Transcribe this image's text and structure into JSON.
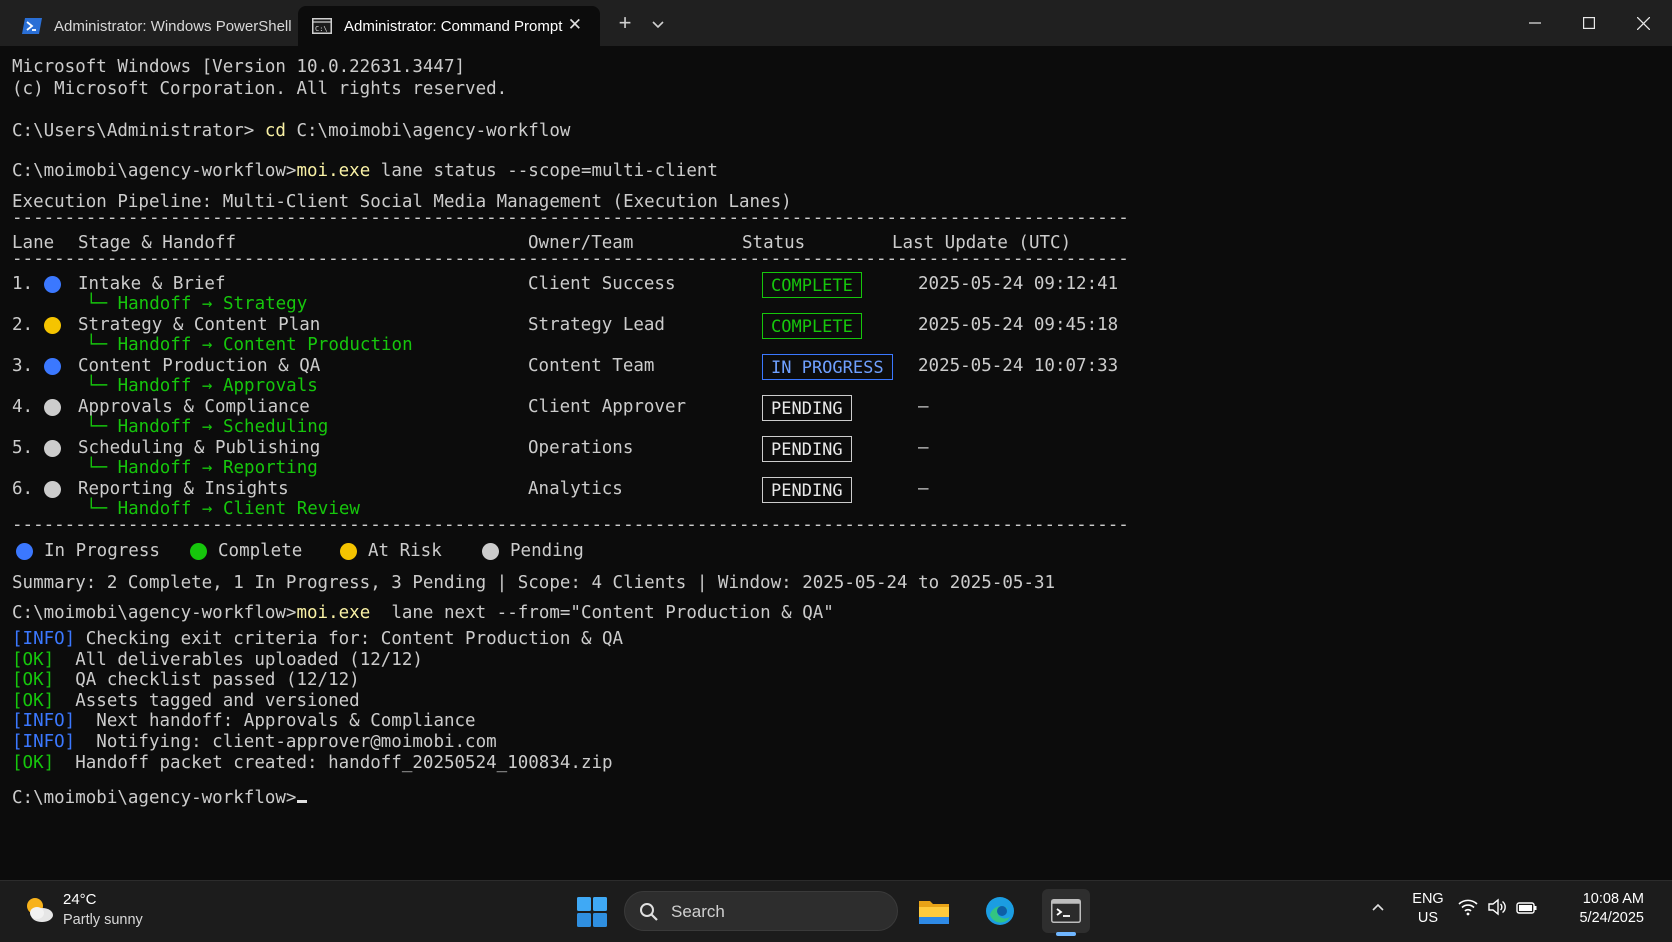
{
  "window": {
    "tabs": [
      {
        "label": "Administrator: Windows PowerShell",
        "icon": "powershell-icon"
      },
      {
        "label": "Administrator: Command Prompt",
        "icon": "cmd-icon",
        "active": true
      }
    ],
    "new_tab": "+",
    "dropdown": "chevron-down-icon",
    "controls": [
      "minimize-icon",
      "maximize-icon",
      "close-icon"
    ]
  },
  "terminal": {
    "banner_1": "Microsoft Windows [Version 10.0.22631.3447]",
    "banner_2": "(c) Microsoft Corporation. All rights reserved.",
    "prompt_1": "C:\\Users\\Administrator> ",
    "cmd_1_keyword": "cd",
    "cmd_1_rest": " C:\\moimobi\\agency-workflow",
    "prompt_2": "C:\\moimobi\\agency-workflow>",
    "cmd_2_exe": "moi.exe",
    "cmd_2_rest": " lane status --scope=multi-client",
    "pipeline_title": "Execution Pipeline: Multi-Client Social Media Management (Execution Lanes)",
    "separator": "----------------------------------------------------------------------------------------------------------",
    "headers": {
      "lane": "Lane",
      "stage": "Stage & Handoff",
      "owner": "Owner/Team",
      "status": "Status",
      "updated": "Last Update (UTC)"
    },
    "lanes": [
      {
        "num": "1.",
        "dot": "#3b78ff",
        "stage": "Intake & Brief",
        "handoff": "└─ Handoff → Strategy",
        "owner": "Client Success",
        "status": "COMPLETE",
        "status_kind": "complete",
        "updated": "2025-05-24 09:12:41"
      },
      {
        "num": "2.",
        "dot": "#f5c400",
        "stage": "Strategy & Content Plan",
        "handoff": "└─ Handoff → Content Production",
        "owner": "Strategy Lead",
        "status": "COMPLETE",
        "status_kind": "complete",
        "updated": "2025-05-24 09:45:18"
      },
      {
        "num": "3.",
        "dot": "#3b78ff",
        "stage": "Content Production & QA",
        "handoff": "└─ Handoff → Approvals",
        "owner": "Content Team",
        "status": "IN PROGRESS",
        "status_kind": "progress",
        "updated": "2025-05-24 10:07:33"
      },
      {
        "num": "4.",
        "dot": "#cccccc",
        "stage": "Approvals & Compliance",
        "handoff": "└─ Handoff → Scheduling",
        "owner": "Client Approver",
        "status": "PENDING",
        "status_kind": "pending",
        "updated": "—"
      },
      {
        "num": "5.",
        "dot": "#cccccc",
        "stage": "Scheduling & Publishing",
        "handoff": "└─ Handoff → Reporting",
        "owner": "Operations",
        "status": "PENDING",
        "status_kind": "pending",
        "updated": "—"
      },
      {
        "num": "6.",
        "dot": "#cccccc",
        "stage": "Reporting & Insights",
        "handoff": "└─ Handoff → Client Review",
        "owner": "Analytics",
        "status": "PENDING",
        "status_kind": "pending",
        "updated": "—"
      }
    ],
    "legend": [
      {
        "label": "In Progress",
        "color": "#3b78ff"
      },
      {
        "label": "Complete",
        "color": "#16c60c"
      },
      {
        "label": "At Risk",
        "color": "#f5c400"
      },
      {
        "label": "Pending",
        "color": "#cccccc"
      }
    ],
    "summary": "Summary: 2 Complete, 1 In Progress, 3 Pending | Scope: 4 Clients | Window: 2025-05-24 to 2025-05-31",
    "prompt_3": "C:\\moimobi\\agency-workflow>",
    "cmd_3_exe": "moi.exe",
    "cmd_3_rest": "  lane next --from=\"Content Production & QA\"",
    "log": [
      {
        "tag": "[INFO]",
        "kind": "info",
        "text": " Checking exit criteria for: Content Production & QA"
      },
      {
        "tag": "[OK]",
        "kind": "ok",
        "text": "  All deliverables uploaded (12/12)"
      },
      {
        "tag": "[OK]",
        "kind": "ok",
        "text": "  QA checklist passed (12/12)"
      },
      {
        "tag": "[OK]",
        "kind": "ok",
        "text": "  Assets tagged and versioned"
      },
      {
        "tag": "[INFO]",
        "kind": "info",
        "text": "  Next handoff: Approvals & Compliance"
      },
      {
        "tag": "[INFO]",
        "kind": "info",
        "text": "  Notifying: client-approver@moimobi.com"
      },
      {
        "tag": "[OK]",
        "kind": "ok",
        "text": "  Handoff packet created: handoff_20250524_100834.zip"
      }
    ],
    "prompt_4": "C:\\moimobi\\agency-workflow>"
  },
  "taskbar": {
    "weather_temp": "24°C",
    "weather_desc": "Partly sunny",
    "search_label": "Search",
    "lang_1": "ENG",
    "lang_2": "US",
    "time": "10:08 AM",
    "date": "5/24/2025"
  }
}
